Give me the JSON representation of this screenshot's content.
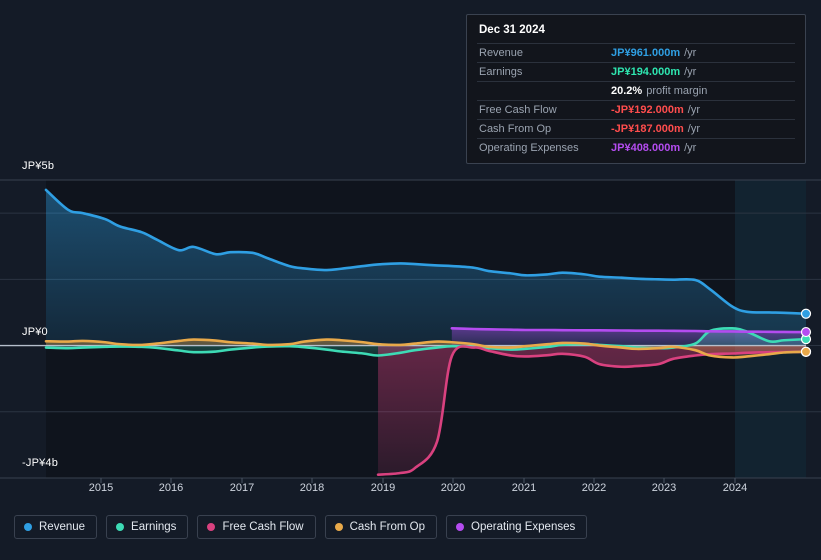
{
  "tooltip": {
    "date": "Dec 31 2024",
    "rows": [
      {
        "label": "Revenue",
        "value": "JP¥961.000m",
        "unit": "/yr",
        "color": "#2f9fe3"
      },
      {
        "label": "Earnings",
        "value": "JP¥194.000m",
        "unit": "/yr",
        "color": "#2ee6b0"
      },
      {
        "label": "",
        "value": "20.2%",
        "unit": "profit margin",
        "color": "#ffffff",
        "is_margin": true
      },
      {
        "label": "Free Cash Flow",
        "value": "-JP¥192.000m",
        "unit": "/yr",
        "color": "#ff4d4d"
      },
      {
        "label": "Cash From Op",
        "value": "-JP¥187.000m",
        "unit": "/yr",
        "color": "#ff4d4d"
      },
      {
        "label": "Operating Expenses",
        "value": "JP¥408.000m",
        "unit": "/yr",
        "color": "#b44cf0"
      }
    ]
  },
  "legend": {
    "items": [
      {
        "label": "Revenue",
        "color": "#2f9fe3"
      },
      {
        "label": "Earnings",
        "color": "#3ddbb5"
      },
      {
        "label": "Free Cash Flow",
        "color": "#d9417f"
      },
      {
        "label": "Cash From Op",
        "color": "#e8a94a"
      },
      {
        "label": "Operating Expenses",
        "color": "#b44cf0"
      }
    ]
  },
  "axis": {
    "y_top": "JP¥5b",
    "y_zero": "JP¥0",
    "y_bottom": "-JP¥4b"
  },
  "chart_data": {
    "type": "area",
    "title": "",
    "xlabel": "",
    "ylabel": "",
    "ylim": [
      -4000,
      5000
    ],
    "y_unit": "JP¥ millions",
    "grid": true,
    "legend_position": "bottom",
    "x_tick_labels": [
      "2015",
      "2016",
      "2017",
      "2018",
      "2019",
      "2020",
      "2021",
      "2022",
      "2023",
      "2024"
    ],
    "x_tick_positions": [
      101,
      171,
      242,
      312,
      383,
      453,
      524,
      594,
      664,
      735
    ],
    "y_gridline_values": [
      4000,
      2000,
      0,
      -2000,
      -4000
    ],
    "forecast_start_x": 735,
    "x": [
      2014.6,
      2014.9,
      2015.1,
      2015.4,
      2015.6,
      2015.9,
      2016.1,
      2016.4,
      2016.6,
      2016.9,
      2017.1,
      2017.4,
      2017.6,
      2017.9,
      2018.1,
      2018.4,
      2018.6,
      2018.9,
      2019.1,
      2019.4,
      2019.6,
      2019.9,
      2020.1,
      2020.4,
      2020.6,
      2020.9,
      2021.1,
      2021.4,
      2021.6,
      2021.9,
      2022.1,
      2022.4,
      2022.6,
      2022.9,
      2023.1,
      2023.4,
      2023.6,
      2023.9,
      2024.1,
      2024.4,
      2024.6,
      2024.9
    ],
    "series": [
      {
        "name": "Revenue",
        "color": "#2f9fe3",
        "fill": true,
        "values": [
          4700,
          4100,
          4000,
          3820,
          3600,
          3420,
          3200,
          2880,
          2980,
          2760,
          2820,
          2800,
          2640,
          2400,
          2330,
          2280,
          2320,
          2400,
          2450,
          2480,
          2460,
          2420,
          2400,
          2350,
          2250,
          2180,
          2120,
          2150,
          2200,
          2150,
          2080,
          2050,
          2020,
          2000,
          1990,
          1980,
          1700,
          1180,
          1020,
          1000,
          990,
          961
        ],
        "end_value": 961
      },
      {
        "name": "Earnings",
        "color": "#3ddbb5",
        "fill": true,
        "values": [
          -60,
          -80,
          -60,
          -40,
          -30,
          -40,
          -70,
          -150,
          -200,
          -180,
          -120,
          -60,
          -30,
          -20,
          -50,
          -120,
          -180,
          -240,
          -300,
          -220,
          -140,
          -60,
          -20,
          -40,
          -80,
          -120,
          -100,
          -40,
          20,
          40,
          20,
          -20,
          -60,
          -80,
          -60,
          60,
          440,
          520,
          420,
          130,
          160,
          194
        ],
        "end_value": 194
      },
      {
        "name": "Free Cash Flow",
        "color": "#d9417f",
        "fill": true,
        "values": [
          null,
          null,
          null,
          null,
          null,
          null,
          null,
          null,
          null,
          null,
          null,
          null,
          null,
          null,
          null,
          null,
          null,
          null,
          -3900,
          -3850,
          -3700,
          -2900,
          -320,
          -60,
          -160,
          -300,
          -330,
          -290,
          -250,
          -340,
          -560,
          -640,
          -620,
          -560,
          -400,
          -300,
          -260,
          -240,
          -220,
          -200,
          -196,
          -192
        ],
        "end_value": -192
      },
      {
        "name": "Cash From Op",
        "color": "#e8a94a",
        "fill": true,
        "values": [
          130,
          120,
          140,
          100,
          40,
          20,
          60,
          140,
          180,
          150,
          100,
          60,
          20,
          40,
          120,
          180,
          160,
          100,
          40,
          20,
          60,
          120,
          100,
          40,
          -40,
          -60,
          -20,
          40,
          80,
          60,
          0,
          -60,
          -100,
          -80,
          -40,
          -140,
          -300,
          -360,
          -330,
          -260,
          -210,
          -187
        ],
        "end_value": -187
      },
      {
        "name": "Operating Expenses",
        "color": "#b44cf0",
        "fill": true,
        "values": [
          null,
          null,
          null,
          null,
          null,
          null,
          null,
          null,
          null,
          null,
          null,
          null,
          null,
          null,
          null,
          null,
          null,
          null,
          null,
          null,
          null,
          null,
          520,
          500,
          490,
          480,
          470,
          470,
          465,
          460,
          460,
          455,
          450,
          450,
          445,
          440,
          430,
          425,
          420,
          415,
          410,
          408
        ],
        "end_value": 408
      }
    ]
  }
}
